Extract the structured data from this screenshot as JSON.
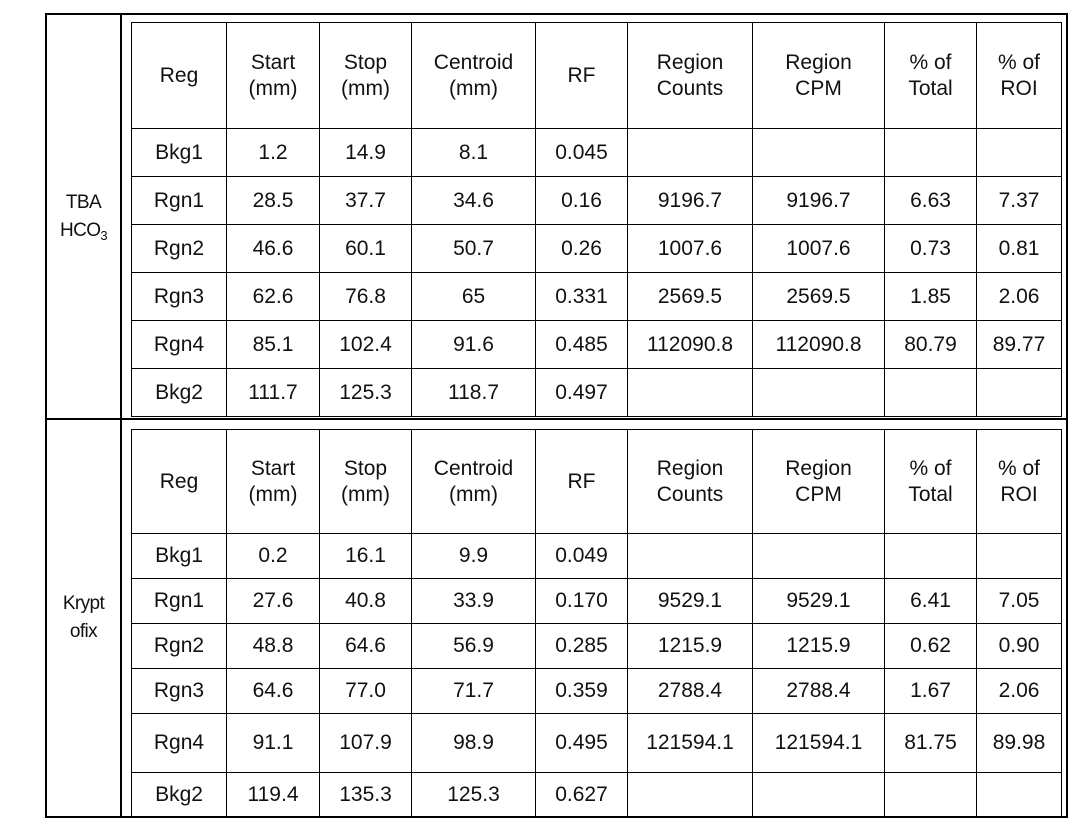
{
  "document": {
    "type": "radio-tlc-region-analysis-table",
    "columns": [
      {
        "key": "reg",
        "l1": "Reg",
        "l2": ""
      },
      {
        "key": "start",
        "l1": "Start",
        "l2": "(mm)"
      },
      {
        "key": "stop",
        "l1": "Stop",
        "l2": "(mm)"
      },
      {
        "key": "centroid",
        "l1": "Centroid",
        "l2": "(mm)"
      },
      {
        "key": "rf",
        "l1": "RF",
        "l2": ""
      },
      {
        "key": "rcounts",
        "l1": "Region",
        "l2": "Counts"
      },
      {
        "key": "rcpm",
        "l1": "Region",
        "l2": "CPM"
      },
      {
        "key": "ptotal",
        "l1": "% of",
        "l2": "Total"
      },
      {
        "key": "proi",
        "l1": "% of",
        "l2": "ROI"
      }
    ]
  },
  "sections": [
    {
      "label_lines": [
        "TBA",
        "HCO"
      ],
      "label_subscript": "3",
      "label_plain": "TBA HCO3",
      "rows": [
        {
          "reg": "Bkg1",
          "start": "1.2",
          "stop": "14.9",
          "centroid": "8.1",
          "rf": "0.045",
          "rcounts": "",
          "rcpm": "",
          "ptotal": "",
          "proi": ""
        },
        {
          "reg": "Rgn1",
          "start": "28.5",
          "stop": "37.7",
          "centroid": "34.6",
          "rf": "0.16",
          "rcounts": "9196.7",
          "rcpm": "9196.7",
          "ptotal": "6.63",
          "proi": "7.37"
        },
        {
          "reg": "Rgn2",
          "start": "46.6",
          "stop": "60.1",
          "centroid": "50.7",
          "rf": "0.26",
          "rcounts": "1007.6",
          "rcpm": "1007.6",
          "ptotal": "0.73",
          "proi": "0.81"
        },
        {
          "reg": "Rgn3",
          "start": "62.6",
          "stop": "76.8",
          "centroid": "65",
          "rf": "0.331",
          "rcounts": "2569.5",
          "rcpm": "2569.5",
          "ptotal": "1.85",
          "proi": "2.06"
        },
        {
          "reg": "Rgn4",
          "start": "85.1",
          "stop": "102.4",
          "centroid": "91.6",
          "rf": "0.485",
          "rcounts": "112090.8",
          "rcpm": "112090.8",
          "ptotal": "80.79",
          "proi": "89.77"
        },
        {
          "reg": "Bkg2",
          "start": "111.7",
          "stop": "125.3",
          "centroid": "118.7",
          "rf": "0.497",
          "rcounts": "",
          "rcpm": "",
          "ptotal": "",
          "proi": ""
        }
      ]
    },
    {
      "label_lines": [
        "Krypt",
        "ofix"
      ],
      "label_subscript": "",
      "label_plain": "Kryptofix",
      "rows": [
        {
          "reg": "Bkg1",
          "start": "0.2",
          "stop": "16.1",
          "centroid": "9.9",
          "rf": "0.049",
          "rcounts": "",
          "rcpm": "",
          "ptotal": "",
          "proi": ""
        },
        {
          "reg": "Rgn1",
          "start": "27.6",
          "stop": "40.8",
          "centroid": "33.9",
          "rf": "0.170",
          "rcounts": "9529.1",
          "rcpm": "9529.1",
          "ptotal": "6.41",
          "proi": "7.05"
        },
        {
          "reg": "Rgn2",
          "start": "48.8",
          "stop": "64.6",
          "centroid": "56.9",
          "rf": "0.285",
          "rcounts": "1215.9",
          "rcpm": "1215.9",
          "ptotal": "0.62",
          "proi": "0.90"
        },
        {
          "reg": "Rgn3",
          "start": "64.6",
          "stop": "77.0",
          "centroid": "71.7",
          "rf": "0.359",
          "rcounts": "2788.4",
          "rcpm": "2788.4",
          "ptotal": "1.67",
          "proi": "2.06"
        },
        {
          "reg": "Rgn4",
          "start": "91.1",
          "stop": "107.9",
          "centroid": "98.9",
          "rf": "0.495",
          "rcounts": "121594.1",
          "rcpm": "121594.1",
          "ptotal": "81.75",
          "proi": "89.98"
        },
        {
          "reg": "Bkg2",
          "start": "119.4",
          "stop": "135.3",
          "centroid": "125.3",
          "rf": "0.627",
          "rcounts": "",
          "rcpm": "",
          "ptotal": "",
          "proi": ""
        }
      ]
    }
  ],
  "style": {
    "border_color": "#000000",
    "text_color": "#111111",
    "background": "#ffffff"
  }
}
